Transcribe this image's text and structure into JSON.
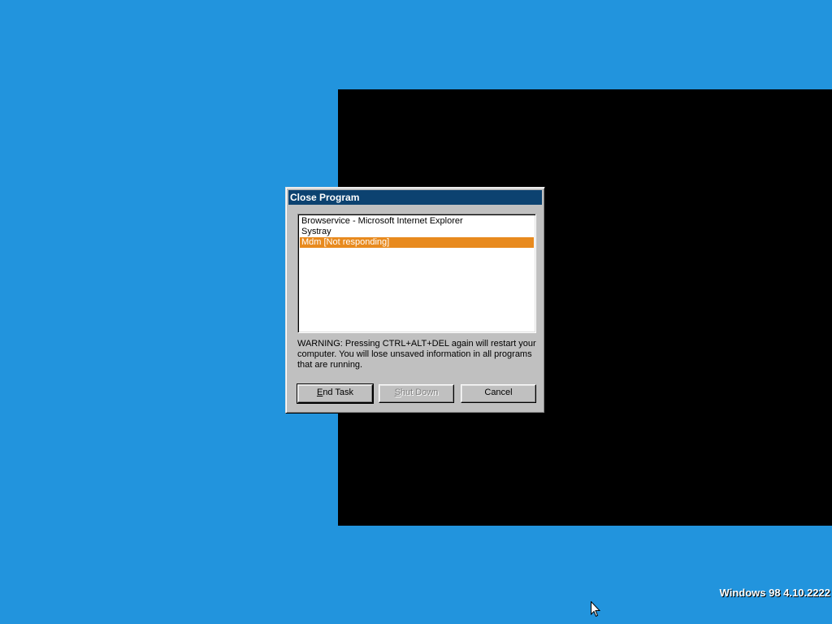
{
  "dialog": {
    "title": "Close Program",
    "programs": [
      "Browservice - Microsoft Internet Explorer",
      "Systray",
      "Mdm [Not responding]"
    ],
    "selected_index": 2,
    "warning": "WARNING: Pressing CTRL+ALT+DEL again will restart your computer. You will lose unsaved information in all programs that are running.",
    "buttons": {
      "end_task": "End Task",
      "shut_down": "Shut Down",
      "cancel": "Cancel"
    }
  },
  "desktop": {
    "version_text": "Windows 98 4.10.2222"
  },
  "colors": {
    "desktop_bg": "#2294dd",
    "titlebar": "#0c4270",
    "selection": "#e88a1e"
  },
  "icons": [
    "mouse-pointer-icon"
  ]
}
